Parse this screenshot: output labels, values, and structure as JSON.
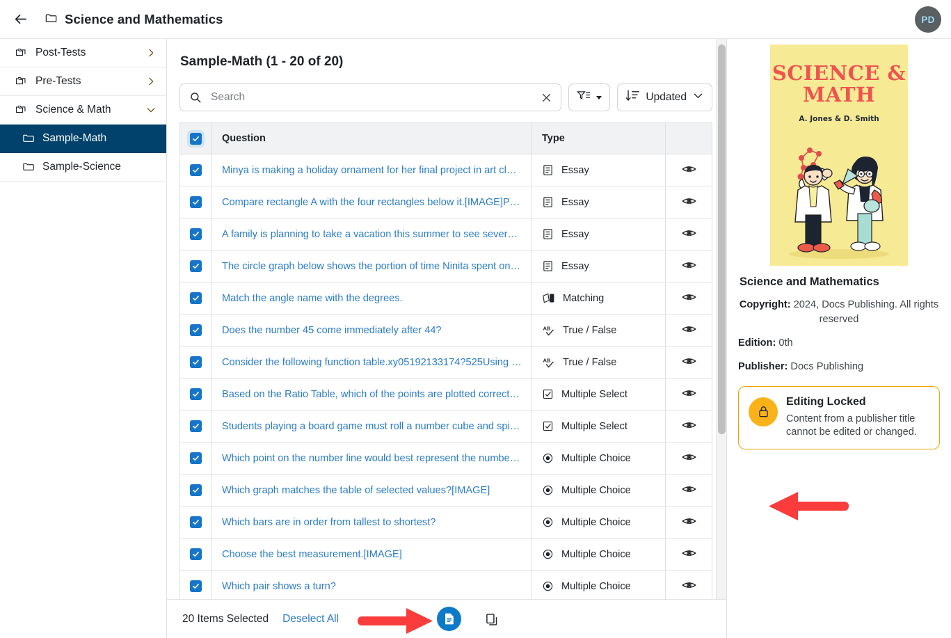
{
  "header": {
    "back_icon": "back-arrow-icon",
    "folder_icon": "folder-icon",
    "title": "Science and Mathematics",
    "avatar_initials": "PD"
  },
  "sidebar": {
    "items": [
      {
        "label": "Post-Tests",
        "icon": "folders-icon",
        "chevron": "chevron-right-icon",
        "selected": false,
        "child": false
      },
      {
        "label": "Pre-Tests",
        "icon": "folders-icon",
        "chevron": "chevron-right-icon",
        "selected": false,
        "child": false
      },
      {
        "label": "Science & Math",
        "icon": "folders-icon",
        "chevron": "chevron-down-icon",
        "selected": false,
        "child": false
      },
      {
        "label": "Sample-Math",
        "icon": "folder-icon",
        "chevron": "",
        "selected": true,
        "child": true
      },
      {
        "label": "Sample-Science",
        "icon": "folder-icon",
        "chevron": "",
        "selected": false,
        "child": true
      }
    ]
  },
  "main": {
    "list_title": "Sample-Math (1 - 20 of 20)",
    "search": {
      "placeholder": "Search",
      "value": "",
      "search_icon": "search-icon",
      "clear_icon": "close-icon"
    },
    "filter_button": {
      "icon": "filter-icon",
      "label": ""
    },
    "sort_button": {
      "icon": "sort-descending-icon",
      "label": "Updated",
      "chevron": "chevron-down-icon"
    },
    "table": {
      "select_all_checked": true,
      "columns": [
        "",
        "Question",
        "Type",
        ""
      ],
      "rows": [
        {
          "checked": true,
          "question": "Minya is making a holiday ornament for her final project in art class…",
          "type": "Essay",
          "type_icon": "essay-icon",
          "action_icon": "eye-icon"
        },
        {
          "checked": true,
          "question": "Compare rectangle A with the four rectangles below it.[IMAGE]Part …",
          "type": "Essay",
          "type_icon": "essay-icon",
          "action_icon": "eye-icon"
        },
        {
          "checked": true,
          "question": "A family is planning to take a vacation this summer to see several n…",
          "type": "Essay",
          "type_icon": "essay-icon",
          "action_icon": "eye-icon"
        },
        {
          "checked": true,
          "question": "The circle graph below shows the portion of time Ninita spent on h…",
          "type": "Essay",
          "type_icon": "essay-icon",
          "action_icon": "eye-icon"
        },
        {
          "checked": true,
          "question": "Match the angle name with the degrees.",
          "type": "Matching",
          "type_icon": "matching-icon",
          "action_icon": "eye-icon"
        },
        {
          "checked": true,
          "question": "Does the number 45 come immediately after 44?",
          "type": "True / False",
          "type_icon": "true-false-icon",
          "action_icon": "eye-icon"
        },
        {
          "checked": true,
          "question": "Consider the following function table.xy05192133174?525Using the…",
          "type": "True / False",
          "type_icon": "true-false-icon",
          "action_icon": "eye-icon"
        },
        {
          "checked": true,
          "question": "Based on the Ratio Table, which of the points are plotted correctly …",
          "type": "Multiple Select",
          "type_icon": "multiple-select-icon",
          "action_icon": "eye-icon"
        },
        {
          "checked": true,
          "question": "Students playing a board game must roll a number cube and spin t…",
          "type": "Multiple Select",
          "type_icon": "multiple-select-icon",
          "action_icon": "eye-icon"
        },
        {
          "checked": true,
          "question": "Which point on the number line would best represent the number …",
          "type": "Multiple Choice",
          "type_icon": "multiple-choice-icon",
          "action_icon": "eye-icon"
        },
        {
          "checked": true,
          "question": "Which graph matches the table of selected values?[IMAGE]",
          "type": "Multiple Choice",
          "type_icon": "multiple-choice-icon",
          "action_icon": "eye-icon"
        },
        {
          "checked": true,
          "question": "Which bars are in order from tallest to shortest?",
          "type": "Multiple Choice",
          "type_icon": "multiple-choice-icon",
          "action_icon": "eye-icon"
        },
        {
          "checked": true,
          "question": "Choose the best measurement.[IMAGE]",
          "type": "Multiple Choice",
          "type_icon": "multiple-choice-icon",
          "action_icon": "eye-icon"
        },
        {
          "checked": true,
          "question": "Which pair shows a turn?",
          "type": "Multiple Choice",
          "type_icon": "multiple-choice-icon",
          "action_icon": "eye-icon"
        }
      ]
    },
    "selection_bar": {
      "count_label": "20 Items Selected",
      "deselect_label": "Deselect All",
      "primary_action_icon": "document-add-icon",
      "secondary_action_icon": "copy-icon"
    }
  },
  "detail": {
    "cover": {
      "title_line1": "SCIENCE &",
      "title_line2": "MATH",
      "authors": "A. Jones & D. Smith",
      "bg_color": "#f7ea94",
      "title_color": "#ef5350"
    },
    "title": "Science and Mathematics",
    "copyright_label": "Copyright:",
    "copyright_value": "2024, Docs Publishing. All rights reserved",
    "edition_label": "Edition:",
    "edition_value": "0th",
    "publisher_label": "Publisher:",
    "publisher_value": "Docs Publishing",
    "lock_card": {
      "icon": "lock-icon",
      "heading": "Editing Locked",
      "body": "Content from a publisher title cannot be edited or changed.",
      "border_color": "#f0a500",
      "icon_bg": "#f9b21a"
    }
  },
  "annotations": {
    "arrow_color": "#fa3c3c",
    "arrow_bottom": "arrow-right-annotation",
    "arrow_panel": "arrow-left-annotation"
  },
  "colors": {
    "selected_nav": "#00426b",
    "link": "#2b7cc4",
    "checkbox": "#1575c9",
    "primary_button": "#0d7ac9"
  }
}
